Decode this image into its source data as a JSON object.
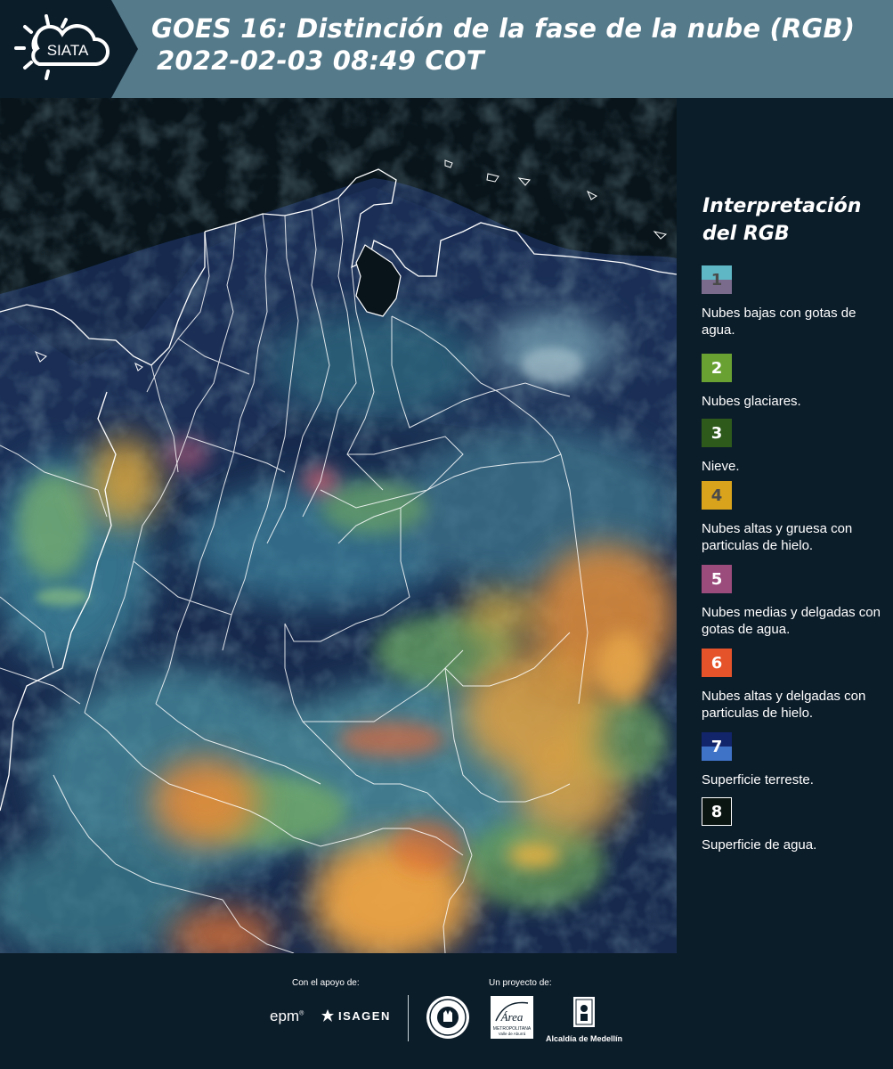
{
  "header": {
    "title_line1": "GOES 16: Distinción de la fase de la nube (RGB)",
    "title_line2": "2022-02-03 08:49 COT",
    "logo_text": "SIATA",
    "logo_icon": "sun-cloud-icon"
  },
  "legend": {
    "title": "Interpretación del RGB",
    "items": [
      {
        "number": "1",
        "label": "Nubes bajas con gotas de agua.",
        "color_top": "#5fb6c4",
        "color_bottom": "#7a6b8d",
        "number_color": "#4a4a4a"
      },
      {
        "number": "2",
        "label": "Nubes glaciares.",
        "color": "#6aa133",
        "number_color": "#ffffff"
      },
      {
        "number": "3",
        "label": "Nieve.",
        "color": "#2e5a1c",
        "number_color": "#ffffff"
      },
      {
        "number": "4",
        "label": "Nubes altas y gruesa con particulas de hielo.",
        "color": "#d9a31c",
        "number_color": "#4a4a4a"
      },
      {
        "number": "5",
        "label": "Nubes medias y delgadas con gotas de agua.",
        "color": "#9b4b7c",
        "number_color": "#ffffff"
      },
      {
        "number": "6",
        "label": "Nubes altas y delgadas con particulas de hielo.",
        "color": "#e5532a",
        "number_color": "#ffffff"
      },
      {
        "number": "7",
        "label": "Superficie terreste.",
        "color_top": "#12246a",
        "color_bottom": "#3f73c8",
        "number_color": "#ffffff"
      },
      {
        "number": "8",
        "label": "Superficie de agua.",
        "color": "#0a1410",
        "border": "#ffffff",
        "number_color": "#ffffff"
      }
    ]
  },
  "footer": {
    "support_label": "Con el apoyo de:",
    "project_label": "Un proyecto de:",
    "epm": "epm",
    "isagen": "ISAGEN",
    "area_logo": "Área",
    "area_sub": "METROPOLITANA",
    "area_sub2": "Valle de Aburrá",
    "alcaldia": "Alcaldía de Medellín"
  },
  "map": {
    "content": "GOES-16 cloud phase RGB satellite image over Colombia",
    "colors": {
      "land": "#1a2d52",
      "water": "#07120e",
      "ice_thick": "#e8a23a",
      "ice_thin": "#e5622a",
      "glaciated": "#6fae63",
      "low_water": "#4f8ea8",
      "borders": "#ffffff"
    }
  }
}
